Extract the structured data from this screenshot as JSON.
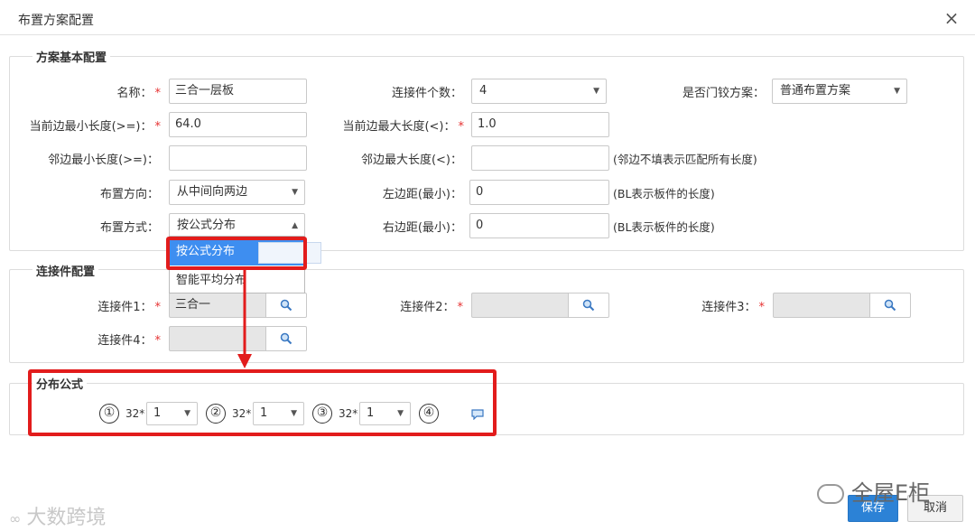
{
  "dialog": {
    "title": "布置方案配置",
    "close": "×"
  },
  "basic": {
    "legend": "方案基本配置",
    "name": {
      "label": "名称：",
      "value": "三合一层板"
    },
    "connector_count": {
      "label": "连接件个数：",
      "value": "4"
    },
    "door_hinge": {
      "label": "是否门铰方案：",
      "value": "普通布置方案"
    },
    "cur_min": {
      "label": "当前边最小长度(>=)：",
      "value": "64.0"
    },
    "cur_max": {
      "label": "当前边最大长度(<)：",
      "value": "1.0"
    },
    "adj_min": {
      "label": "邻边最小长度(>=)：",
      "value": ""
    },
    "adj_max": {
      "label": "邻边最大长度(<)：",
      "value": "",
      "hint": "(邻边不填表示匹配所有长度)"
    },
    "direction": {
      "label": "布置方向：",
      "value": "从中间向两边"
    },
    "left_margin": {
      "label": "左边距(最小)：",
      "value": "0",
      "hint": "(BL表示板件的长度)"
    },
    "method": {
      "label": "布置方式：",
      "value": "按公式分布",
      "options": [
        "按公式分布",
        "智能平均分布"
      ]
    },
    "right_margin": {
      "label": "右边距(最小)：",
      "value": "0",
      "hint": "(BL表示板件的长度)"
    }
  },
  "connectors": {
    "legend": "连接件配置",
    "c1": {
      "label": "连接件1：",
      "value": "三合一"
    },
    "c2": {
      "label": "连接件2：",
      "value": ""
    },
    "c3": {
      "label": "连接件3：",
      "value": ""
    },
    "c4": {
      "label": "连接件4：",
      "value": ""
    }
  },
  "formula": {
    "legend": "分布公式",
    "circles": [
      "①",
      "②",
      "③",
      "④"
    ],
    "mult": "32*",
    "values": [
      "1",
      "1",
      "1"
    ]
  },
  "buttons": {
    "save": "保存",
    "cancel": "取消"
  },
  "watermarks": {
    "left": "大数跨境",
    "right": "全屋E柜"
  },
  "colors": {
    "primary": "#2c82d6",
    "highlight": "#3e8ef0",
    "annotation": "#e21c1c",
    "required": "#e63232"
  }
}
